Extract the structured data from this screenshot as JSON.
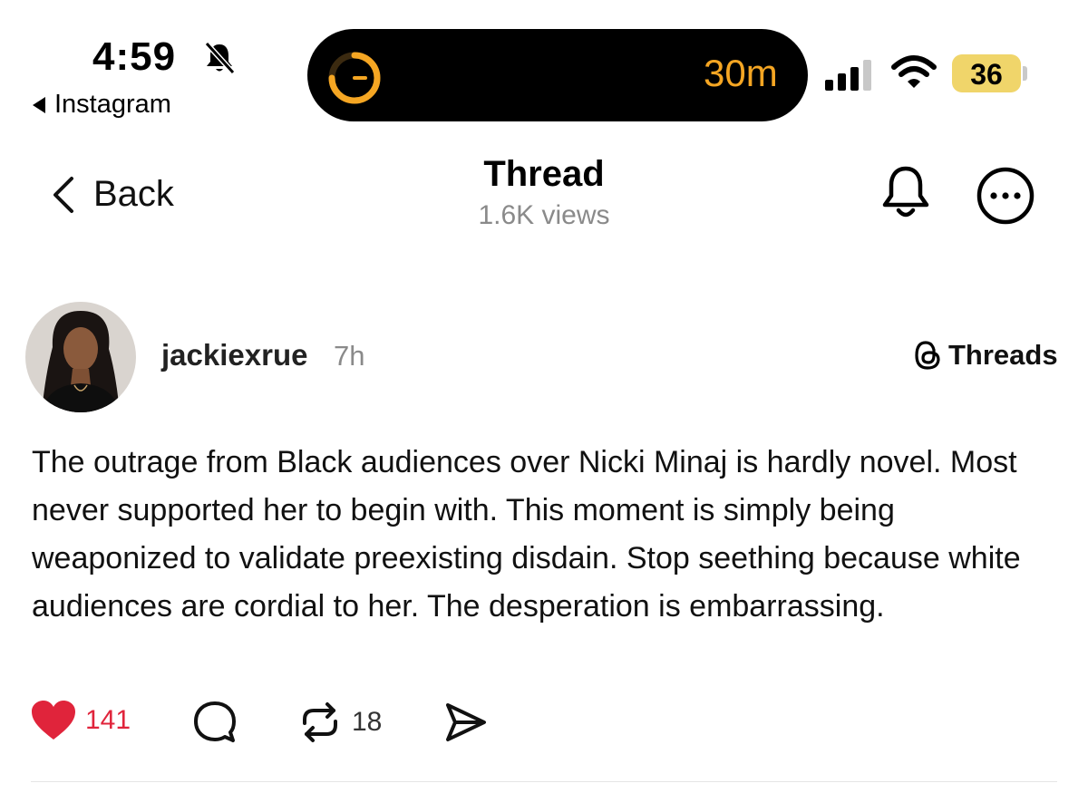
{
  "status_bar": {
    "time": "4:59",
    "back_app": "Instagram",
    "island_timer": "30m",
    "battery": "36",
    "icons": [
      "bell-slash-icon",
      "timer-icon",
      "signal-icon",
      "wifi-icon",
      "battery-icon"
    ]
  },
  "header": {
    "back_label": "Back",
    "title": "Thread",
    "views": "1.6K views",
    "icons": [
      "chevron-left-icon",
      "bell-icon",
      "more-icon"
    ]
  },
  "post": {
    "username": "jackiexrue",
    "time_ago": "7h",
    "source_label": "Threads",
    "text": "The outrage from Black audiences over Nicki Minaj is hardly novel. Most never supported her to begin with. This moment is simply being weaponized to validate preexisting disdain. Stop seething because white audiences are cordial to her. The desperation is embarrassing.",
    "actions": {
      "likes": "141",
      "reposts": "18"
    }
  },
  "colors": {
    "like": "#e0243b",
    "island_text": "#f5a623",
    "battery": "#f0d56a",
    "muted": "#8a8a8a"
  }
}
